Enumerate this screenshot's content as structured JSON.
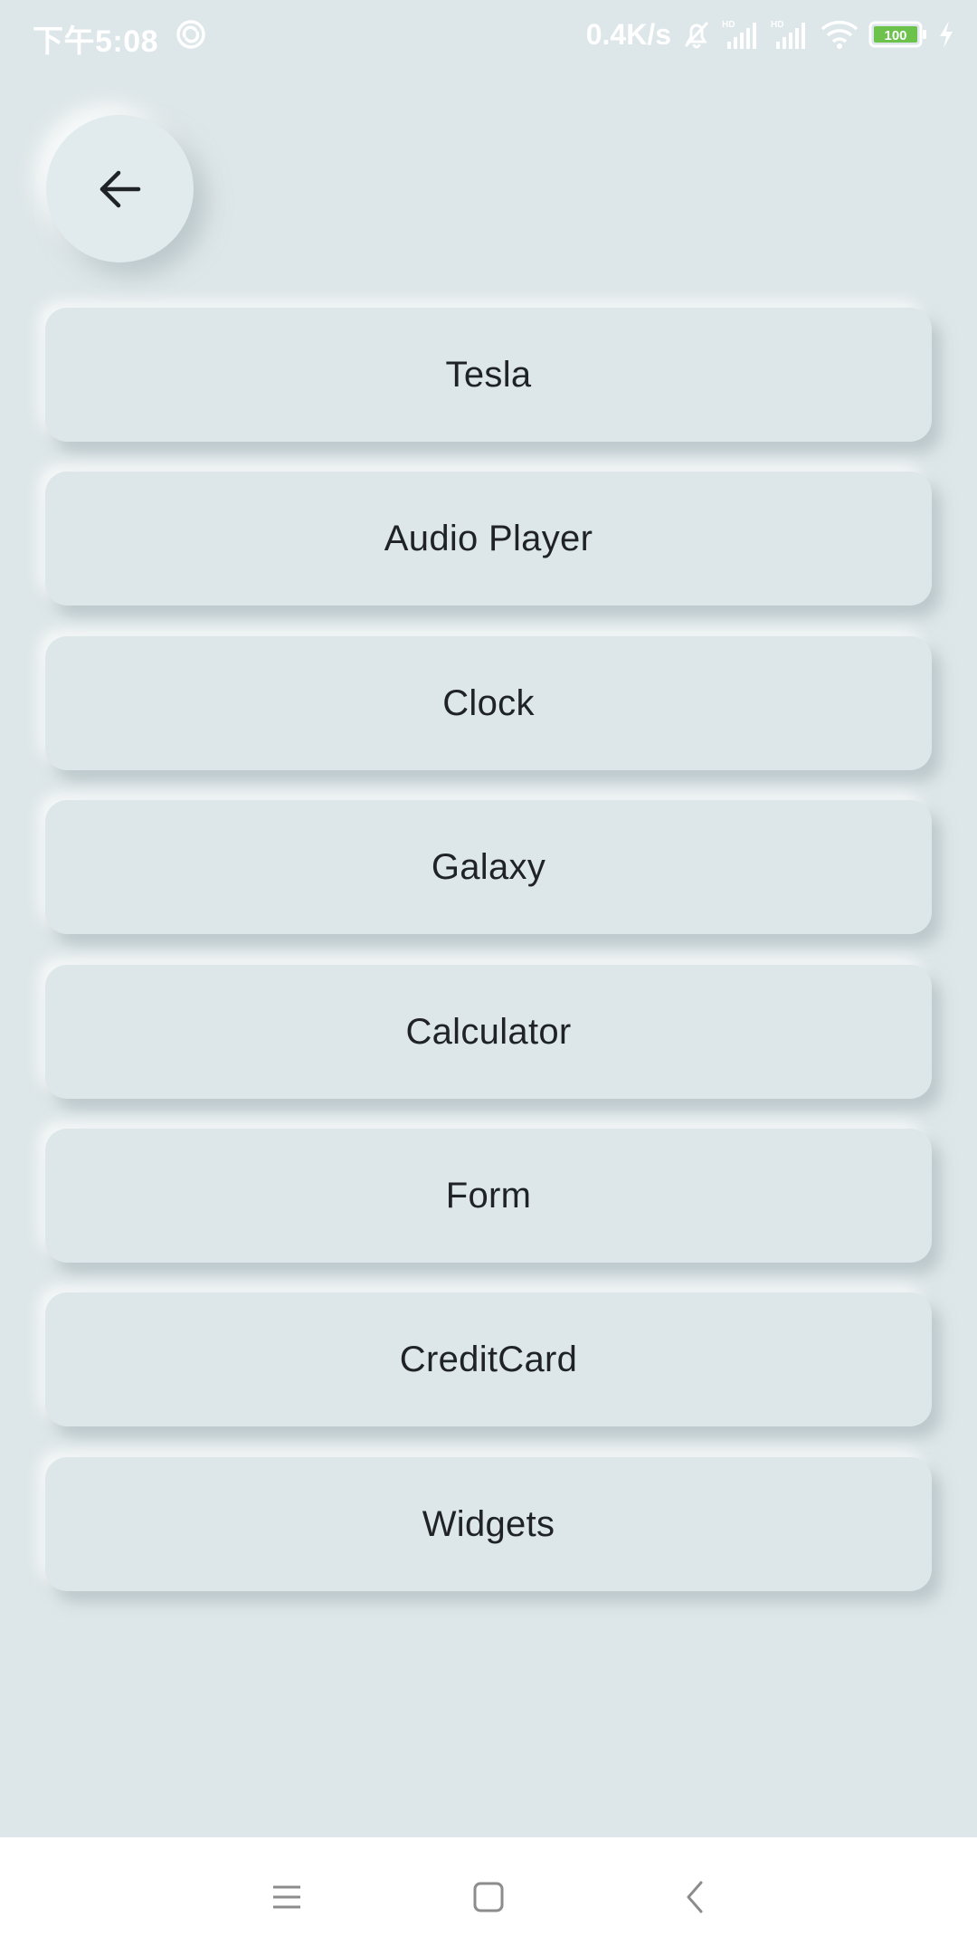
{
  "status_bar": {
    "time": "下午5:08",
    "net_speed": "0.4K/s",
    "battery_level": "100",
    "icons": [
      "sync-icon",
      "mute-icon",
      "hd-signal-icon",
      "hd-signal-icon",
      "wifi-icon",
      "battery-icon",
      "charging-icon"
    ]
  },
  "header": {
    "back_icon": "arrow-left-icon"
  },
  "menu": {
    "items": [
      {
        "label": "Tesla"
      },
      {
        "label": "Audio Player"
      },
      {
        "label": "Clock"
      },
      {
        "label": "Galaxy"
      },
      {
        "label": "Calculator"
      },
      {
        "label": "Form"
      },
      {
        "label": "CreditCard"
      },
      {
        "label": "Widgets"
      }
    ]
  },
  "nav_bar": {
    "icons": [
      "menu-icon",
      "home-square-icon",
      "back-chevron-icon"
    ]
  },
  "colors": {
    "background": "#dde6e8",
    "text": "#1f2326",
    "battery_fill": "#6cc24a"
  }
}
